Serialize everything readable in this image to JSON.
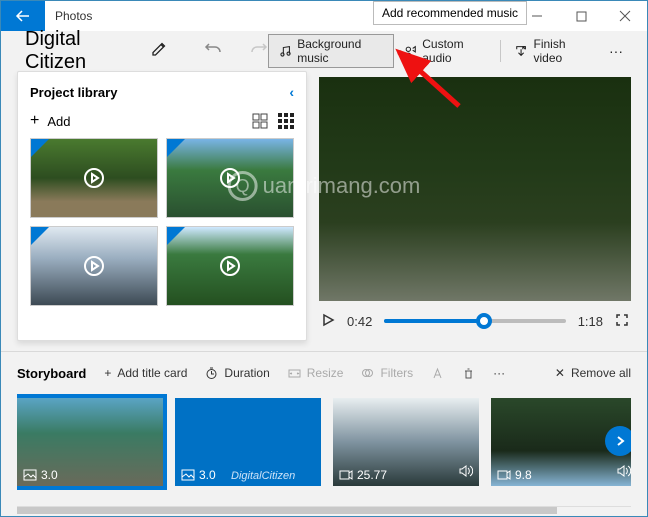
{
  "app_title": "Photos",
  "tooltip": "Add recommended music",
  "project_title": "Digital Citizen",
  "toolbar": {
    "bg_music": "Background music",
    "custom_audio": "Custom audio",
    "finish_video": "Finish video"
  },
  "library": {
    "heading": "Project library",
    "add": "Add"
  },
  "player": {
    "current": "0:42",
    "duration": "1:18"
  },
  "storyboard": {
    "title": "Storyboard",
    "add_title": "Add title card",
    "duration": "Duration",
    "resize": "Resize",
    "filters": "Filters",
    "remove_all": "Remove all",
    "clips": [
      {
        "dur": "3.0",
        "kind": "image"
      },
      {
        "dur": "3.0",
        "kind": "image",
        "blue": true
      },
      {
        "dur": "25.77",
        "kind": "video"
      },
      {
        "dur": "9.8",
        "kind": "video"
      }
    ]
  },
  "watermark": "uantrimang.com"
}
